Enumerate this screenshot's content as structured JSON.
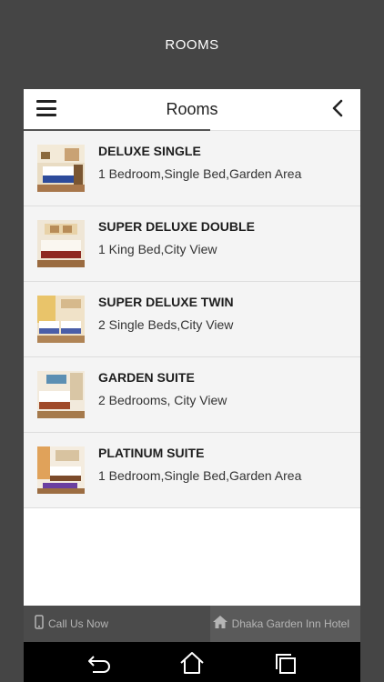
{
  "page_title": "ROOMS",
  "header": {
    "title": "Rooms",
    "menu_icon": "hamburger-menu-icon",
    "back_icon": "chevron-left-icon"
  },
  "rooms": [
    {
      "name": "DELUXE SINGLE",
      "description": "1 Bedroom,Single Bed,Garden Area"
    },
    {
      "name": "SUPER DELUXE DOUBLE",
      "description": "1 King Bed,City View"
    },
    {
      "name": "SUPER DELUXE TWIN",
      "description": "2 Single Beds,City View"
    },
    {
      "name": "GARDEN SUITE",
      "description": "2 Bedrooms, City View"
    },
    {
      "name": "PLATINUM SUITE",
      "description": "1 Bedroom,Single Bed,Garden Area"
    }
  ],
  "footer": {
    "call_label": "Call Us Now",
    "call_icon": "phone-icon",
    "hotel_label": "Dhaka Garden Inn Hotel",
    "hotel_icon": "home-icon"
  },
  "navbar": {
    "back_icon": "back-arrow-icon",
    "home_icon": "home-outline-icon",
    "recents_icon": "recent-apps-icon"
  },
  "colors": {
    "page_background": "#454545",
    "list_background": "#f4f4f4",
    "footer_background": "#4b4b4b",
    "navbar_background": "#000000"
  }
}
